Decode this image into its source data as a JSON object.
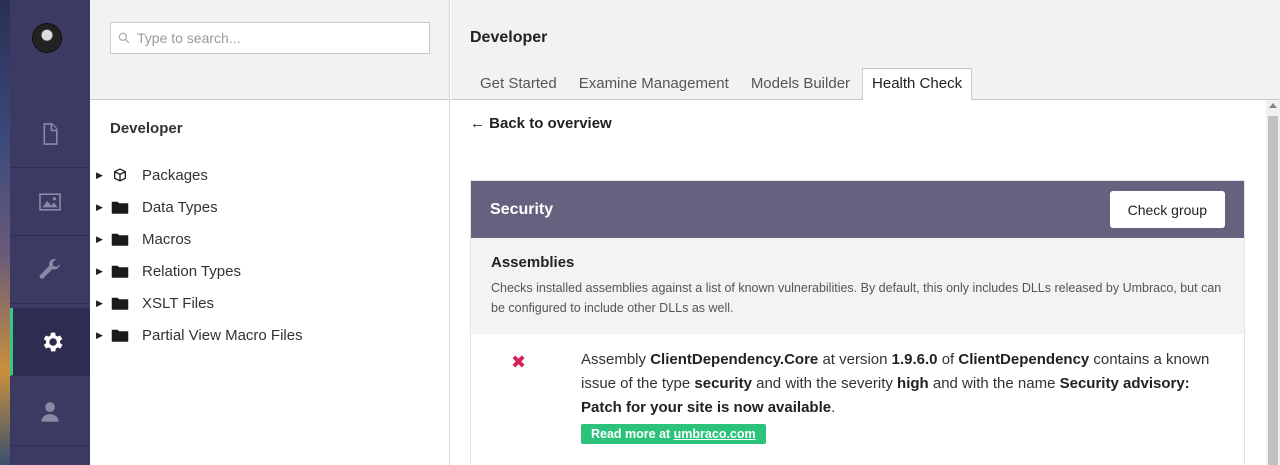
{
  "sections": {
    "items": [
      {
        "name": "content",
        "icon": "document-icon"
      },
      {
        "name": "media",
        "icon": "image-icon"
      },
      {
        "name": "settings",
        "icon": "wrench-icon"
      },
      {
        "name": "developer",
        "icon": "gear-icon"
      },
      {
        "name": "users",
        "icon": "user-icon"
      }
    ],
    "active": "developer",
    "accent_color": "#35c786"
  },
  "tree": {
    "search_placeholder": "Type to search...",
    "title": "Developer",
    "items": [
      {
        "label": "Packages",
        "icon": "package-icon"
      },
      {
        "label": "Data Types",
        "icon": "folder-icon"
      },
      {
        "label": "Macros",
        "icon": "folder-icon"
      },
      {
        "label": "Relation Types",
        "icon": "folder-icon"
      },
      {
        "label": "XSLT Files",
        "icon": "folder-icon"
      },
      {
        "label": "Partial View Macro Files",
        "icon": "folder-icon"
      }
    ]
  },
  "main": {
    "title": "Developer",
    "tabs": [
      "Get Started",
      "Examine Management",
      "Models Builder",
      "Health Check"
    ],
    "active_tab": "Health Check",
    "back_link": "← Back to overview",
    "group": {
      "title": "Security",
      "check_button": "Check group",
      "header_color": "#67617f",
      "check": {
        "name": "Assemblies",
        "description": "Checks installed assemblies against a list of known vulnerabilities. By default, this only includes DLLs released by Umbraco, but can be configured to include other DLLs as well."
      },
      "result": {
        "status_icon": "error-x-icon",
        "status_color": "#d42054",
        "p1": "Assembly ",
        "assembly": "ClientDependency.Core",
        "p2": " at version ",
        "version": "1.9.6.0",
        "p3": " of ",
        "package": "ClientDependency",
        "p4": " contains a known issue of the type ",
        "type": "security",
        "p5": " and with the severity ",
        "severity": "high",
        "p6": " and with the name ",
        "advisory": "Security advisory: Patch for your site is now available",
        "p7": ".",
        "read_more_prefix": "Read more at ",
        "read_more_link": "umbraco.com",
        "read_more_color": "#2bc37c"
      }
    }
  }
}
